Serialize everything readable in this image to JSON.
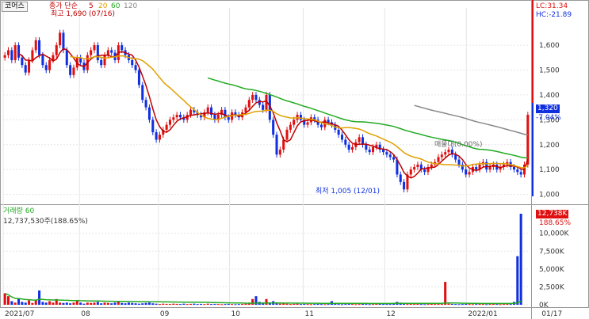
{
  "header": {
    "tab_label": "코어스",
    "indicator_label": "종가 단순",
    "ma_periods": [
      "5",
      "20",
      "60",
      "120"
    ],
    "ma_colors": [
      "#c00000",
      "#e0a000",
      "#22aa22",
      "#888888"
    ],
    "lc_label": "LC:31.34",
    "hc_label": "HC:-21.89"
  },
  "annotations": {
    "high_label": "최고 1,690 (07/16)",
    "low_label": "최저 1,005 (12/01)",
    "mid_label": "매물대(0.00%)"
  },
  "price_badge": {
    "value": "1,320",
    "change": "-7.04%"
  },
  "volume_header": {
    "label": "거래량",
    "period": "60",
    "value": "12,737,530주(188.65%)"
  },
  "volume_badge": {
    "value": "12,738K",
    "change": "188.65%"
  },
  "colors": {
    "up": "#e01010",
    "down": "#1030e0",
    "axis": "#333333",
    "grid": "#e6e6e6"
  },
  "chart_data": [
    {
      "type": "candlestick",
      "title": "",
      "y_axis_ticks": [
        "1,600",
        "1,500",
        "1,400",
        "1,300",
        "1,200",
        "1,100",
        "1,000"
      ],
      "ylim": [
        970,
        1750
      ],
      "x_tick_labels": [
        "2021/07",
        "08",
        "09",
        "10",
        "11",
        "12",
        "2022/01",
        "01/17"
      ],
      "close": [
        1560,
        1580,
        1540,
        1600,
        1550,
        1520,
        1490,
        1540,
        1580,
        1620,
        1560,
        1520,
        1500,
        1540,
        1560,
        1600,
        1650,
        1580,
        1520,
        1480,
        1510,
        1550,
        1530,
        1500,
        1560,
        1580,
        1600,
        1540,
        1520,
        1560,
        1580,
        1570,
        1540,
        1600,
        1580,
        1560,
        1540,
        1520,
        1500,
        1440,
        1380,
        1350,
        1300,
        1250,
        1220,
        1240,
        1260,
        1280,
        1300,
        1310,
        1320,
        1310,
        1300,
        1320,
        1340,
        1330,
        1320,
        1310,
        1330,
        1350,
        1320,
        1300,
        1320,
        1340,
        1310,
        1300,
        1330,
        1320,
        1310,
        1330,
        1350,
        1380,
        1400,
        1380,
        1360,
        1340,
        1400,
        1300,
        1240,
        1160,
        1180,
        1220,
        1260,
        1280,
        1300,
        1320,
        1300,
        1280,
        1290,
        1310,
        1300,
        1280,
        1270,
        1300,
        1290,
        1280,
        1260,
        1240,
        1220,
        1200,
        1180,
        1190,
        1210,
        1230,
        1200,
        1180,
        1170,
        1190,
        1200,
        1180,
        1170,
        1160,
        1150,
        1140,
        1080,
        1050,
        1020,
        1080,
        1100,
        1110,
        1120,
        1100,
        1090,
        1110,
        1120,
        1130,
        1150,
        1160,
        1170,
        1180,
        1160,
        1140,
        1120,
        1100,
        1080,
        1090,
        1110,
        1100,
        1120,
        1130,
        1100,
        1110,
        1120,
        1100,
        1110,
        1120,
        1130,
        1110,
        1100,
        1090,
        1080,
        1120,
        1320
      ],
      "volume_k": [
        1600,
        1200,
        500,
        300,
        800,
        400,
        300,
        600,
        250,
        600,
        2000,
        400,
        300,
        500,
        300,
        800,
        300,
        250,
        300,
        200,
        300,
        600,
        300,
        150,
        300,
        250,
        300,
        400,
        200,
        300,
        250,
        200,
        300,
        400,
        250,
        200,
        300,
        250,
        200,
        150,
        200,
        250,
        300,
        200,
        150,
        100,
        150,
        120,
        100,
        150,
        120,
        100,
        150,
        100,
        120,
        150,
        100,
        120,
        100,
        150,
        100,
        120,
        100,
        80,
        100,
        120,
        100,
        80,
        100,
        120,
        150,
        300,
        800,
        1200,
        400,
        300,
        800,
        300,
        500,
        200,
        150,
        200,
        150,
        100,
        120,
        150,
        100,
        120,
        100,
        80,
        100,
        120,
        100,
        80,
        100,
        500,
        150,
        100,
        80,
        100,
        120,
        100,
        80,
        100,
        120,
        100,
        80,
        100,
        120,
        150,
        100,
        120,
        100,
        200,
        400,
        300,
        200,
        100,
        150,
        100,
        120,
        100,
        80,
        100,
        120,
        100,
        120,
        100,
        3200,
        150,
        120,
        100,
        80,
        100,
        120,
        100,
        80,
        100,
        120,
        100,
        80,
        100,
        120,
        100,
        80,
        100,
        120,
        100,
        400,
        6800,
        12738
      ],
      "ma_series": [
        {
          "name": "5",
          "period": 5
        },
        {
          "name": "20",
          "period": 20
        },
        {
          "name": "60",
          "period": 60
        },
        {
          "name": "120",
          "period": 120
        }
      ]
    },
    {
      "type": "bar",
      "title": "거래량",
      "y_axis_ticks": [
        "10,000K",
        "7,500K",
        "5,000K",
        "2,500K",
        "0K"
      ],
      "ylim": [
        0,
        12738
      ]
    }
  ]
}
